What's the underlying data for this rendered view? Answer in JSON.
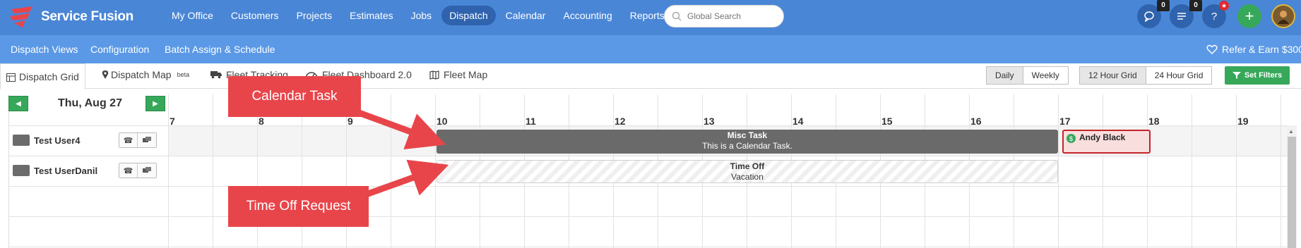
{
  "brand": {
    "name": "Service Fusion"
  },
  "nav": [
    {
      "label": "My Office"
    },
    {
      "label": "Customers"
    },
    {
      "label": "Projects"
    },
    {
      "label": "Estimates"
    },
    {
      "label": "Jobs"
    },
    {
      "label": "Dispatch",
      "active": true
    },
    {
      "label": "Calendar"
    },
    {
      "label": "Accounting"
    },
    {
      "label": "Reports"
    }
  ],
  "search": {
    "placeholder": "Global Search"
  },
  "header_buttons": {
    "chat_count": "0",
    "tasks_count": "0",
    "help_label": "?",
    "add_label": "+"
  },
  "subnav": {
    "items": [
      "Dispatch Views",
      "Configuration",
      "Batch Assign & Schedule"
    ],
    "refer_label": "Refer & Earn $300"
  },
  "tabs": [
    {
      "label": "Dispatch Grid",
      "active": true
    },
    {
      "label": "Dispatch Map",
      "badge": "beta"
    },
    {
      "label": "Fleet Tracking"
    },
    {
      "label": "Fleet Dashboard 2.0"
    },
    {
      "label": "Fleet Map"
    }
  ],
  "view_toggle": {
    "daily": "Daily",
    "weekly": "Weekly",
    "active": "Daily"
  },
  "grid_toggle": {
    "twelve": "12 Hour Grid",
    "twentyfour": "24 Hour Grid",
    "active": "12 Hour Grid"
  },
  "set_filters_label": "Set Filters",
  "date": {
    "label": "Thu, Aug 27"
  },
  "hours": [
    "7",
    "8",
    "9",
    "10",
    "11",
    "12",
    "13",
    "14",
    "15",
    "16",
    "17",
    "18",
    "19"
  ],
  "users": [
    {
      "name": "Test User4"
    },
    {
      "name": "Test UserDanil"
    }
  ],
  "events": {
    "misc": {
      "title": "Misc Task",
      "description": "This is a Calendar Task."
    },
    "time_off": {
      "title": "Time Off",
      "description": "Vacation"
    },
    "andy": {
      "name": "Andy Black",
      "badge": "$"
    }
  },
  "callouts": {
    "calendar_task": "Calendar Task",
    "time_off_request": "Time Off Request"
  },
  "colors": {
    "topbar": "#4a86d6",
    "subbar": "#5b99e6",
    "active_nav": "#2f63ad",
    "green": "#37a85a",
    "callout": "#e8454a"
  }
}
